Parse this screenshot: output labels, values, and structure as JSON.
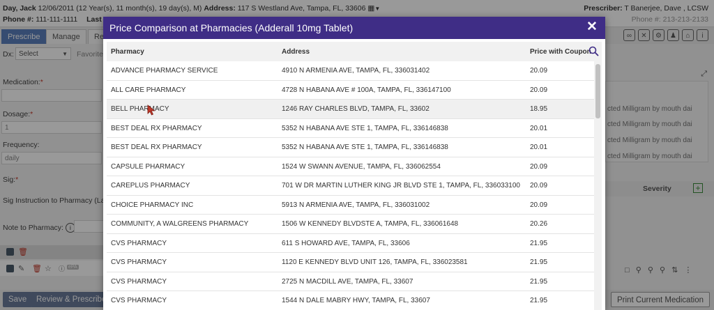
{
  "patient": {
    "line1_pre": "Day, Jack",
    "line1_mid": " 12/06/2011 (12 Year(s), 11 month(s), 19 day(s), M) ",
    "address_label": "Address:",
    "address": " 117 S Westland Ave, Tampa, FL, 33606",
    "phone_label": "Phone #:",
    "phone": " 111-111-1111",
    "last_label": "Last Ap"
  },
  "prescriber": {
    "label": "Prescriber:",
    "name": " T Banerjee, Dave , LCSW",
    "phone_label": "Phone #:",
    "phone": " 213-213-2133"
  },
  "tabs": [
    "Prescribe",
    "Manage",
    "Re"
  ],
  "form": {
    "dx_label": "Dx:",
    "dx_select": "Select",
    "favorites": "Favorite",
    "medication_label": "Medication:",
    "dosage_label": "Dosage:",
    "dosage_value": "1",
    "frequency_label": "Frequency:",
    "frequency_value": "daily",
    "sig_label": "Sig:",
    "sig_instruction": "Sig Instruction to Pharmacy (Lang",
    "note_label": "Note to Pharmacy:"
  },
  "right_panel": {
    "rx_lines": [
      "cted Milligram by mouth dai",
      "cted Milligram by mouth dai",
      "cted Milligram by mouth dai",
      "cted Milligram by mouth dai"
    ],
    "severity_label": "Severity"
  },
  "bottom": {
    "save": "Save",
    "review": "Review & Prescribe",
    "print": "Print Current Medication"
  },
  "modal": {
    "title": "Price Comparison at Pharmacies (Adderall 10mg Tablet)",
    "columns": {
      "pharmacy": "Pharmacy",
      "address": "Address",
      "price": "Price with Coupon"
    },
    "rows": [
      {
        "pharmacy": "ADVANCE PHARMACY SERVICE",
        "address": "4910 N ARMENIA AVE, TAMPA, FL, 336031402",
        "price": "20.09"
      },
      {
        "pharmacy": "ALL CARE PHARMACY",
        "address": "4728 N HABANA AVE # 100A, TAMPA, FL, 336147100",
        "price": "20.09"
      },
      {
        "pharmacy": "BELL PHARMACY",
        "address": "1246 RAY CHARLES BLVD, TAMPA, FL, 33602",
        "price": "18.95"
      },
      {
        "pharmacy": "BEST DEAL RX PHARMACY",
        "address": "5352 N HABANA AVE STE 1, TAMPA, FL, 336146838",
        "price": "20.01"
      },
      {
        "pharmacy": "BEST DEAL RX PHARMACY",
        "address": "5352 N HABANA AVE STE 1, TAMPA, FL, 336146838",
        "price": "20.01"
      },
      {
        "pharmacy": "CAPSULE PHARMACY",
        "address": "1524 W SWANN AVENUE, TAMPA, FL, 336062554",
        "price": "20.09"
      },
      {
        "pharmacy": "CAREPLUS PHARMACY",
        "address": "701 W DR MARTIN LUTHER KING JR BLVD STE 1, TAMPA, FL, 336033100",
        "price": "20.09"
      },
      {
        "pharmacy": "CHOICE PHARMACY INC",
        "address": "5913 N ARMENIA AVE, TAMPA, FL, 336031002",
        "price": "20.09"
      },
      {
        "pharmacy": "COMMUNITY, A WALGREENS PHARMACY",
        "address": "1506 W KENNEDY BLVDSTE A, TAMPA, FL, 336061648",
        "price": "20.26"
      },
      {
        "pharmacy": "CVS PHARMACY",
        "address": "611 S HOWARD AVE, TAMPA, FL, 33606",
        "price": "21.95"
      },
      {
        "pharmacy": "CVS PHARMACY",
        "address": "1120 E KENNEDY BLVD UNIT 126, TAMPA, FL, 336023581",
        "price": "21.95"
      },
      {
        "pharmacy": "CVS PHARMACY",
        "address": "2725 N MACDILL AVE, TAMPA, FL, 33607",
        "price": "21.95"
      },
      {
        "pharmacy": "CVS PHARMACY",
        "address": "1544 N DALE MABRY HWY, TAMPA, FL, 33607",
        "price": "21.95"
      }
    ]
  }
}
